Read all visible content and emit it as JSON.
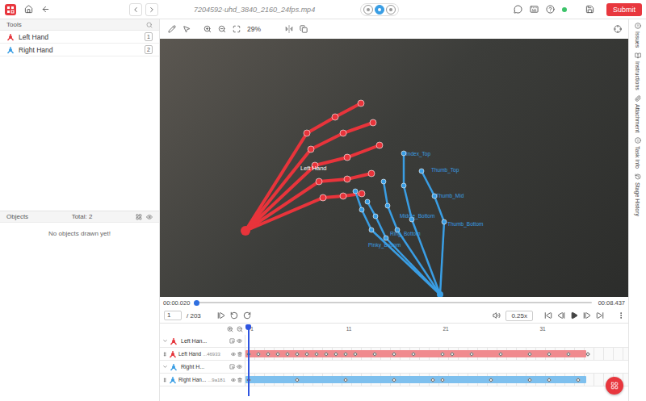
{
  "topbar": {
    "title": "7204592-uhd_3840_2160_24fps.mp4",
    "submit": "Submit",
    "online": true,
    "modes": [
      {
        "selected": false
      },
      {
        "selected": true
      },
      {
        "selected": false
      }
    ]
  },
  "tools": {
    "header": "Tools",
    "items": [
      {
        "label": "Left Hand",
        "badge": "1",
        "color": "#e5353c"
      },
      {
        "label": "Right Hand",
        "badge": "2",
        "color": "#3a9ee4"
      }
    ]
  },
  "objects": {
    "header": "Objects",
    "total": "Total: 2",
    "empty": "No objects drawn yet!"
  },
  "toolbar": {
    "zoom": "29%"
  },
  "canvas": {
    "title_label": "Left Hand",
    "hands": [
      {
        "color": "#e8343b",
        "labels": []
      },
      {
        "color": "#3a9ee4",
        "labels": [
          "Index_Top",
          "Thumb_Top",
          "Thumb_Mid",
          "Thumb_Bottom",
          "Middle_Bottom",
          "Ring_Bottom",
          "Pinky_Bottom"
        ]
      }
    ]
  },
  "player": {
    "current": "00:00.020",
    "duration": "00:08.437",
    "progress": 0,
    "frame": "1",
    "total": "/ 203",
    "speed": "0.25x"
  },
  "timeline": {
    "ticks": [
      "1",
      "11",
      "21",
      "31"
    ],
    "tracks": [
      {
        "group": "Left Han...",
        "name": "Left Hand",
        "id": "...46933",
        "color": "#f08a8e",
        "tool_color": "#e5353c",
        "level": 0.89,
        "expanded": true,
        "keyframes": [
          1,
          2,
          3,
          4,
          5,
          6,
          7,
          8,
          9,
          10,
          11,
          12,
          14,
          16,
          18,
          21,
          22,
          24,
          27,
          30,
          32,
          34,
          36
        ]
      },
      {
        "group": "Right H...",
        "name": "Right Han...",
        "id": "...9a181",
        "color": "#7ec0ee",
        "tool_color": "#3a9ee4",
        "level": 0.89,
        "expanded": true,
        "keyframes": [
          1,
          6,
          11,
          16,
          20,
          21,
          26,
          30,
          32,
          35
        ]
      }
    ]
  },
  "side_tabs": [
    "Issues",
    "Instructions",
    "Attachment",
    "Task Info",
    "Stage History"
  ]
}
